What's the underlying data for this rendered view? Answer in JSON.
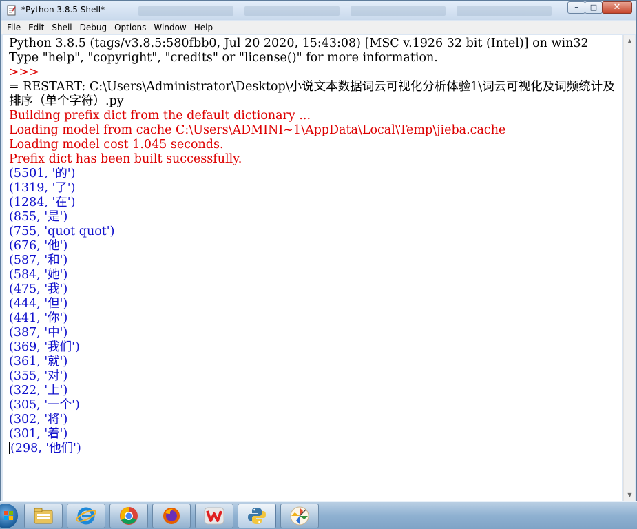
{
  "window": {
    "title": "*Python 3.8.5 Shell*",
    "controls": {
      "minimize": "–",
      "maximize": "□",
      "close": "✕"
    }
  },
  "menu": [
    "File",
    "Edit",
    "Shell",
    "Debug",
    "Options",
    "Window",
    "Help"
  ],
  "shell": {
    "header1": "Python 3.8.5 (tags/v3.8.5:580fbb0, Jul 20 2020, 15:43:08) [MSC v.1926 32 bit (Intel)] on win32",
    "header2": "Type \"help\", \"copyright\", \"credits\" or \"license()\" for more information.",
    "prompt": ">>>",
    "restart": "= RESTART: C:\\Users\\Administrator\\Desktop\\小说文本数据词云可视化分析体验1\\词云可视化及词频统计及排序（单个字符）.py",
    "stderr": [
      "Building prefix dict from the default dictionary ...",
      "Loading model from cache C:\\Users\\ADMINI~1\\AppData\\Local\\Temp\\jieba.cache",
      "Loading model cost 1.045 seconds.",
      "Prefix dict has been built successfully."
    ],
    "results": [
      "(5501, '的')",
      "(1319, '了')",
      "(1284, '在')",
      "(855, '是')",
      "(755, 'quot quot')",
      "(676, '他')",
      "(587, '和')",
      "(584, '她')",
      "(475, '我')",
      "(444, '但')",
      "(441, '你')",
      "(387, '中')",
      "(369, '我们')",
      "(361, '就')",
      "(355, '对')",
      "(322, '上')",
      "(305, '一个')",
      "(302, '将')",
      "(301, '着')",
      "(298, '他们')"
    ]
  },
  "colors": {
    "stdout": "#1111cc",
    "stderr": "#dd0000",
    "prompt": "#dd0000"
  },
  "taskbar": {
    "items": [
      "start-orb",
      "file-explorer-icon",
      "internet-explorer-icon",
      "chrome-icon",
      "firefox-icon",
      "wps-office-icon",
      "python-idle-icon",
      "pinwheel-app-icon"
    ]
  }
}
